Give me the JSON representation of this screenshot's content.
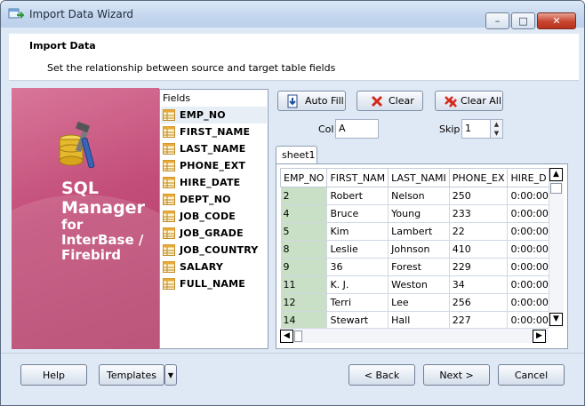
{
  "window": {
    "title": "Import Data Wizard"
  },
  "title_buttons": {
    "minimize": "–",
    "maximize": "□",
    "close": "✕"
  },
  "header": {
    "title": "Import Data",
    "subtitle": "Set the relationship between source and target table fields"
  },
  "banner": {
    "line1": "SQL",
    "line2": "Manager",
    "line3": "for",
    "line4": "InterBase /",
    "line5": "Firebird"
  },
  "fields_panel": {
    "header": "Fields",
    "items": [
      {
        "label": "EMP_NO"
      },
      {
        "label": "FIRST_NAME"
      },
      {
        "label": "LAST_NAME"
      },
      {
        "label": "PHONE_EXT"
      },
      {
        "label": "HIRE_DATE"
      },
      {
        "label": "DEPT_NO"
      },
      {
        "label": "JOB_CODE"
      },
      {
        "label": "JOB_GRADE"
      },
      {
        "label": "JOB_COUNTRY"
      },
      {
        "label": "SALARY"
      },
      {
        "label": "FULL_NAME"
      }
    ]
  },
  "toolbar": {
    "auto_fill": "Auto Fill",
    "clear": "Clear",
    "clear_all": "Clear All"
  },
  "col": {
    "label": "Col",
    "value": "A"
  },
  "skip": {
    "label": "Skip",
    "value": "1"
  },
  "sheet_tab": "sheet1",
  "grid": {
    "columns": [
      "EMP_NO",
      "FIRST_NAM",
      "LAST_NAMI",
      "PHONE_EX",
      "HIRE_D"
    ],
    "rows": [
      [
        "2",
        "Robert",
        "Nelson",
        "250",
        "0:00:00"
      ],
      [
        "4",
        "Bruce",
        "Young",
        "233",
        "0:00:00"
      ],
      [
        "5",
        "Kim",
        "Lambert",
        "22",
        "0:00:00"
      ],
      [
        "8",
        "Leslie",
        "Johnson",
        "410",
        "0:00:00"
      ],
      [
        "9",
        "36",
        "Forest",
        "229",
        "0:00:00"
      ],
      [
        "11",
        "K. J.",
        "Weston",
        "34",
        "0:00:00"
      ],
      [
        "12",
        "Terri",
        "Lee",
        "256",
        "0:00:00"
      ],
      [
        "14",
        "Stewart",
        "Hall",
        "227",
        "0:00:00"
      ]
    ]
  },
  "footer": {
    "help": "Help",
    "templates": "Templates",
    "back": "< Back",
    "next": "Next >",
    "cancel": "Cancel"
  },
  "colors": {
    "banner": "#c24d78",
    "mapped_column": "#c9dfc6",
    "window_bg": "#dfe9f5"
  }
}
